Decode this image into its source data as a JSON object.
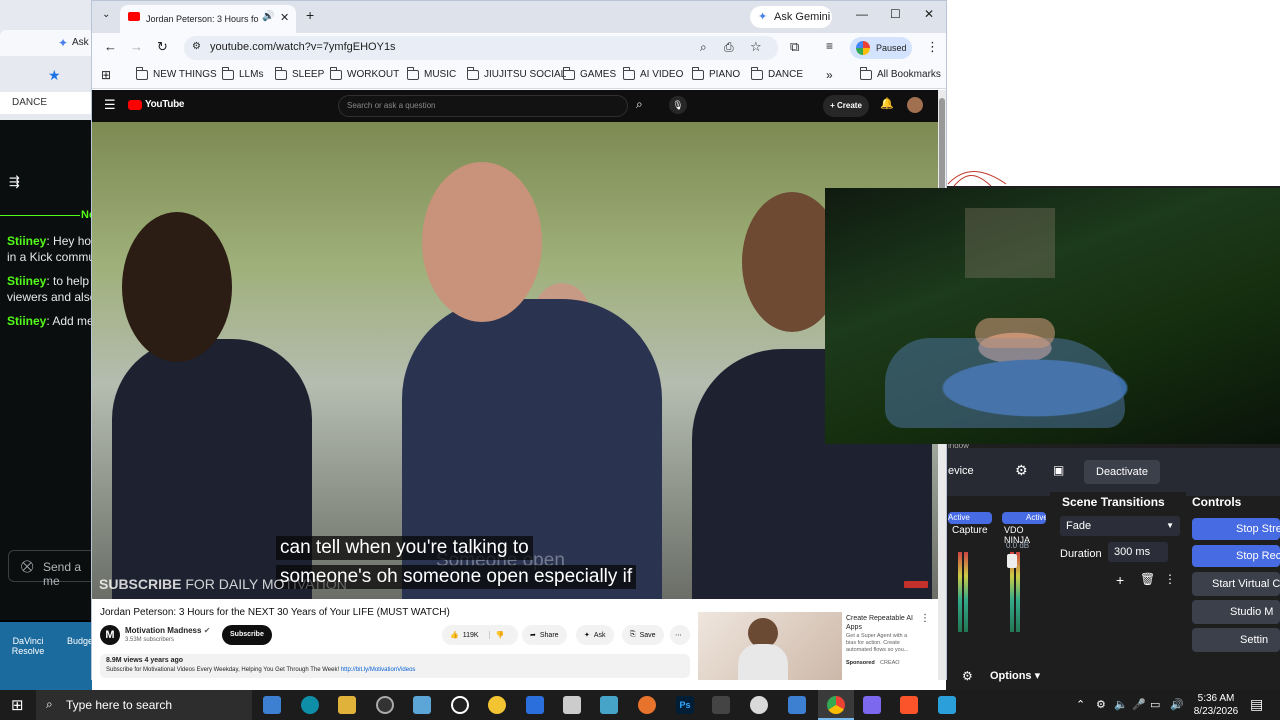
{
  "background_left": {
    "tab_label": "Ask",
    "bookmark_dance": "DANCE",
    "chat": [
      {
        "user": "Stiiney",
        "text": "Hey hom",
        "text2": "in a Kick commu"
      },
      {
        "user": "Stiiney",
        "text": "to help h",
        "text2": "viewers and also"
      },
      {
        "user": "Stiiney",
        "text": "Add me",
        "text2": ""
      }
    ],
    "chat_header_fragment": "Ne",
    "send_placeholder": "Send a me",
    "desktop_icons": [
      "DaVinci Resolve",
      "Budge"
    ]
  },
  "browser": {
    "tab_title": "Jordan Peterson: 3 Hours fo",
    "ask_gemini": "Ask Gemini",
    "url": "youtube.com/watch?v=7ymfgEHOY1s",
    "profile_status": "Paused",
    "bookmarks": [
      "NEW THINGS",
      "LLMs",
      "SLEEP",
      "WORKOUT",
      "MUSIC",
      "JIUJITSU SOCIAL",
      "GAMES",
      "AI VIDEO",
      "PIANO",
      "DANCE"
    ],
    "all_bookmarks": "All Bookmarks"
  },
  "youtube": {
    "logo_text": "YouTube",
    "search_placeholder": "Search or ask a question",
    "create_label": "Create",
    "caption_ghost": "Someone open",
    "caption_line1": "can tell when you're talking to",
    "caption_line2": "someone's oh someone open especially if",
    "watermark_bold": "SUBSCRIBE",
    "watermark_rest": "FOR DAILY MO",
    "watermark_ghost": "TIVATION",
    "video_title": "Jordan Peterson: 3 Hours for the NEXT 30 Years of Your LIFE (MUST WATCH)",
    "channel_name": "Motivation Madness",
    "subscribers": "3.53M subscribers",
    "subscribe_label": "Subscribe",
    "likes": "119K",
    "share_label": "Share",
    "ask_label": "Ask",
    "save_label": "Save",
    "views_line": "8.9M views  4 years ago",
    "description": "Subscribe for Motivational Videos Every Weekday, Helping You Get Through The Week!",
    "description_link": "http://bit.ly/MotivationVideos",
    "ad_title": "Create Repeatable AI Apps",
    "ad_body": "Get a Super Agent with a bias for action. Create automated flows so you...",
    "ad_sponsored": "Sponsored",
    "ad_advertiser": "CREAO"
  },
  "obs": {
    "fragment_device": "evice",
    "deactivate": "Deactivate",
    "scene_transitions": "Scene Transitions",
    "controls": "Controls",
    "transition": "Fade",
    "duration_label": "Duration",
    "duration_value": "300 ms",
    "stop_stream": "Stop Strea",
    "stop_record": "Stop Reco",
    "start_virtual": "Start Virtual Ca",
    "studio_mode": "Studio M",
    "settings": "Settin",
    "options": "Options",
    "mixer_active1": "Active",
    "mixer_active2": "Active",
    "mixer_src1": "Capture",
    "mixer_src2": "VDO NINJA",
    "mixer_db": "0.0 dB",
    "window_frag": "indow"
  },
  "taskbar": {
    "search_placeholder": "Type here to search",
    "time": "5:36 AM",
    "date": "8/23/2026"
  }
}
